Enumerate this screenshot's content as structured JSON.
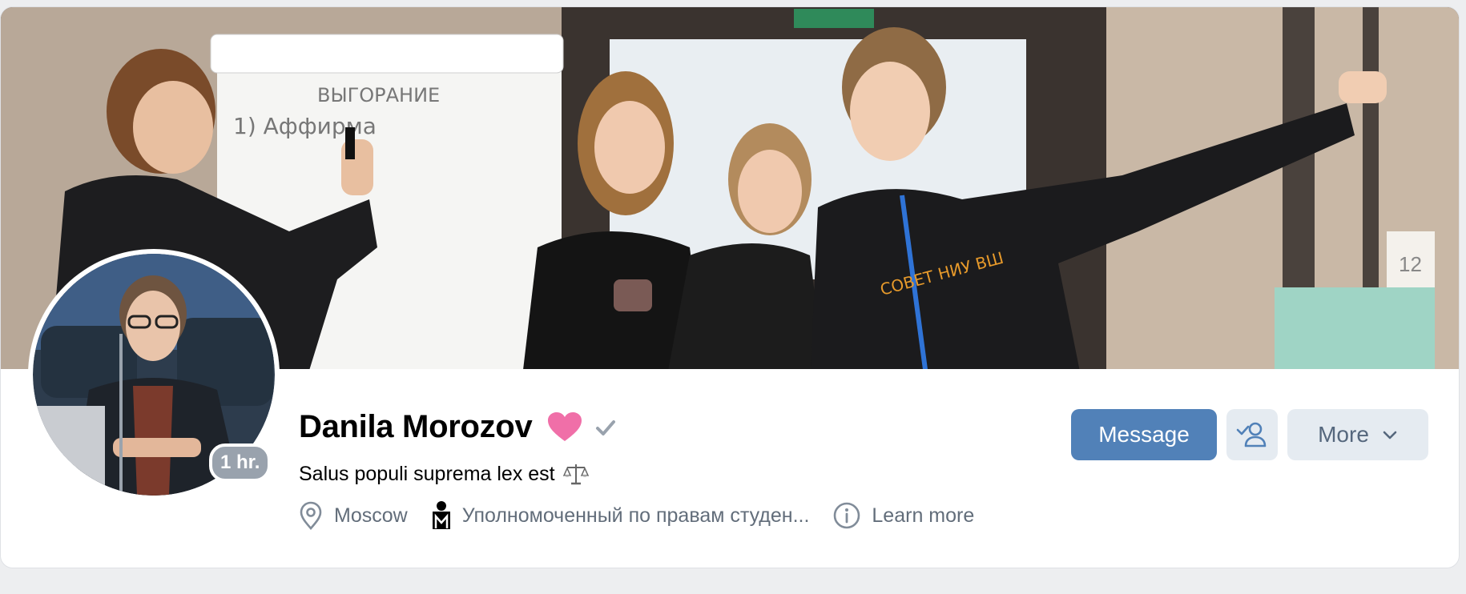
{
  "profile": {
    "name": "Danila Morozov",
    "status_text": "Salus populi suprema lex est",
    "online_badge": "1 hr.",
    "location": "Moscow",
    "occupation": "Уполномоченный по правам студен...",
    "learn_more": "Learn more"
  },
  "cover": {
    "flipchart_title": "ВЫГОРАНИЕ",
    "flipchart_line": "1) Аффирма",
    "shirt_text": "СОВЕТ НИУ ВШ",
    "sign_text": "12"
  },
  "actions": {
    "message_label": "Message",
    "more_label": "More"
  },
  "icons": {
    "heart": "heart-icon",
    "verified": "checkmark-icon",
    "status": "scales-icon",
    "location": "location-pin-icon",
    "occupation": "university-logo-icon",
    "info": "info-circle-icon",
    "friend": "user-check-icon",
    "more": "chevron-down-icon"
  },
  "colors": {
    "accent": "#5181b8",
    "secondary_button": "#e5ebf1",
    "muted_text": "#626d7a",
    "badge": "#99a2ad",
    "heart": "#f06fa8"
  }
}
